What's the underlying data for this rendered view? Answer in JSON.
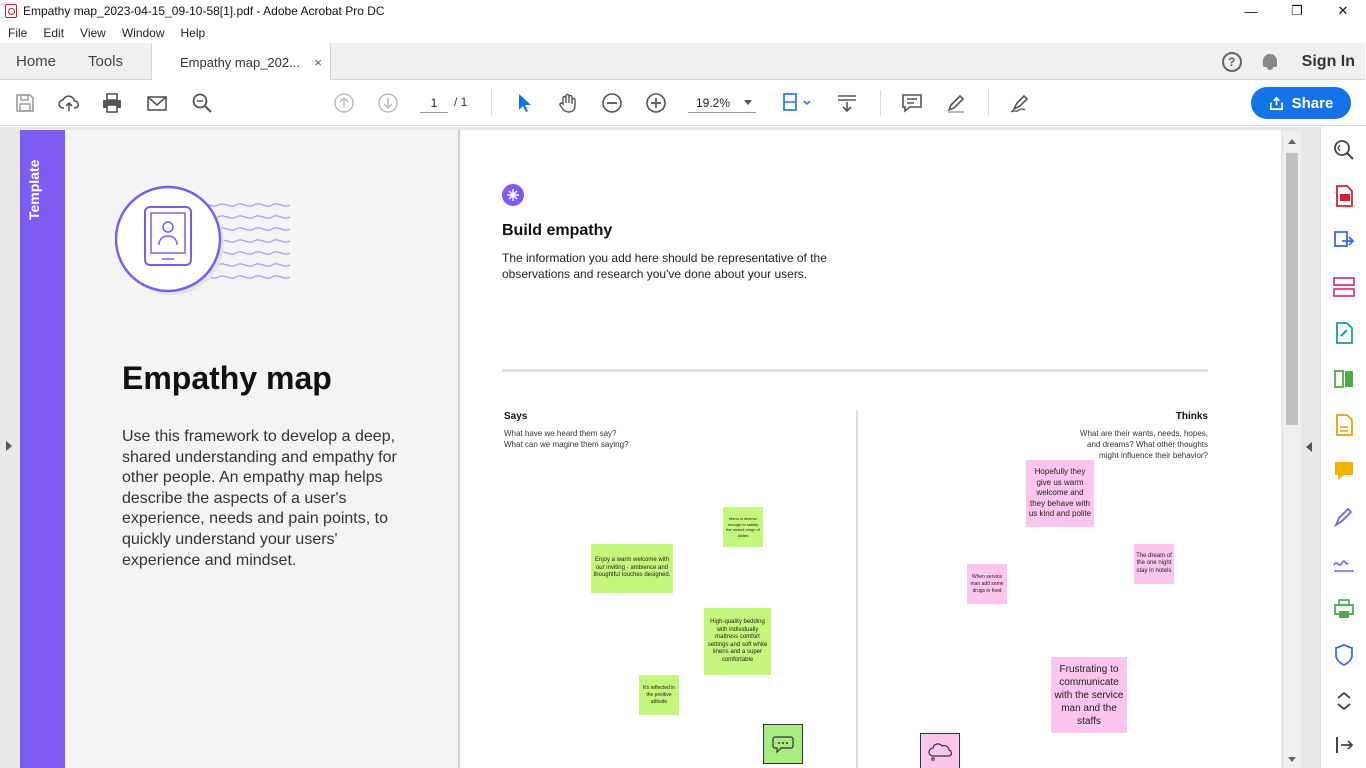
{
  "window": {
    "title": "Empathy map_2023-04-15_09-10-58[1].pdf - Adobe Acrobat Pro DC",
    "minimize": "—",
    "restore": "❐",
    "close": "✕"
  },
  "menu": [
    "File",
    "Edit",
    "View",
    "Window",
    "Help"
  ],
  "tabs": {
    "home": "Home",
    "tools": "Tools",
    "document": "Empathy map_202...",
    "close": "×"
  },
  "header": {
    "help": "?",
    "sign_in": "Sign In"
  },
  "toolbar": {
    "page_current": "1",
    "page_total": "/ 1",
    "zoom": "19.2%",
    "share_label": "Share"
  },
  "template": {
    "strip_label": "Template",
    "title": "Empathy map",
    "description": "Use this framework to develop a deep, shared understanding and empathy for other people. An empathy map helps describe the aspects of a user's experience, needs and pain points, to quickly understand your users' experience and mindset."
  },
  "canvas": {
    "build_title": "Build empathy",
    "build_desc": "The information you add here should be representative of the observations and research you've done about your users.",
    "says": {
      "title": "Says",
      "desc_line1": "What have we heard them say?",
      "desc_line2": "What can we magine them saying?"
    },
    "thinks": {
      "title": "Thinks",
      "desc_line1": "What are their wants, needs, hopes,",
      "desc_line2": "and dreams? What other thoughts",
      "desc_line3": "might influence their behavior?"
    },
    "says_notes": [
      "Menu is diverse enough to satisfy the widest range of tastes",
      "Enjoy a warm welcome with our inviting · ambience and thoughtful touches designed.",
      "High-quality bedding with individually mattress comfort settings and soft white linens and a super comfortable",
      "It's reflected in the positive attitude"
    ],
    "thinks_notes": [
      "Hopefully they give us warm welcome and they behave with us kind and polite",
      "The dream of the one night stay in hotels",
      "When service man add some drugs in food",
      "Frustrating to communicate with the service man and the staffs"
    ]
  },
  "colors": {
    "accent_purple": "#7c5cf4",
    "share_blue": "#1473e6",
    "sticky_green": "#c4f67b",
    "sticky_pink": "#fbc5ed"
  }
}
